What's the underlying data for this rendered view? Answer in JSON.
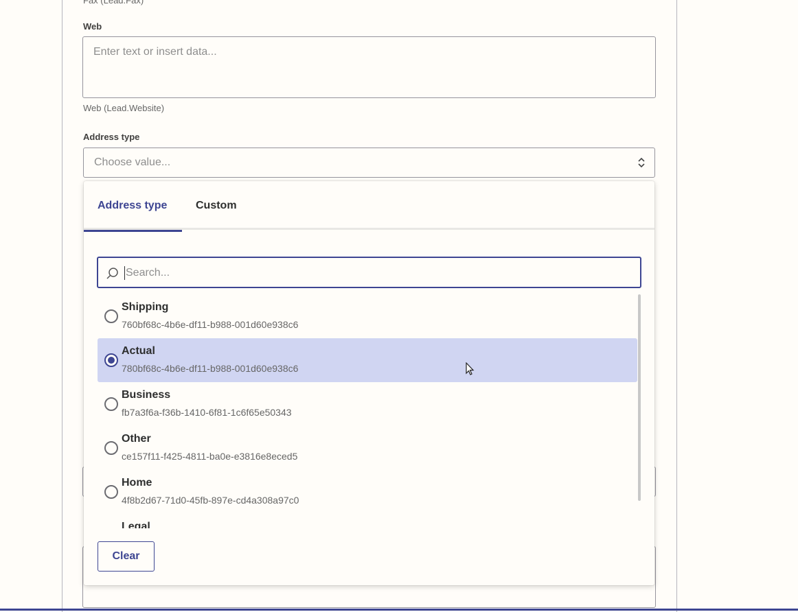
{
  "form": {
    "fax_helper_cut": "Fax (Lead.Fax)",
    "web": {
      "label": "Web",
      "placeholder": "Enter text or insert data...",
      "helper": "Web (Lead.Website)"
    },
    "address_type": {
      "label": "Address type",
      "placeholder": "Choose value...",
      "chevron_icon": "up-down-chevron-icon"
    }
  },
  "dropdown": {
    "tabs": [
      {
        "label": "Address type",
        "active": true
      },
      {
        "label": "Custom",
        "active": false
      }
    ],
    "search": {
      "placeholder": "Search...",
      "value": "",
      "icon": "search-icon"
    },
    "options": [
      {
        "name": "Shipping",
        "id": "760bf68c-4b6e-df11-b988-001d60e938c6",
        "selected": false
      },
      {
        "name": "Actual",
        "id": "780bf68c-4b6e-df11-b988-001d60e938c6",
        "selected": true
      },
      {
        "name": "Business",
        "id": "fb7a3f6a-f36b-1410-6f81-1c6f65e50343",
        "selected": false
      },
      {
        "name": "Other",
        "id": "ce157f11-f425-4811-ba0e-e3816e8eced5",
        "selected": false
      },
      {
        "name": "Home",
        "id": "4f8b2d67-71d0-45fb-897e-cd4a308a97c0",
        "selected": false
      },
      {
        "name": "Legal",
        "id": "",
        "selected": false
      }
    ],
    "clear_label": "Clear"
  },
  "colors": {
    "accent": "#3d4592",
    "selected_bg": "#d0d5f2",
    "page_bg": "#fffdf9"
  }
}
